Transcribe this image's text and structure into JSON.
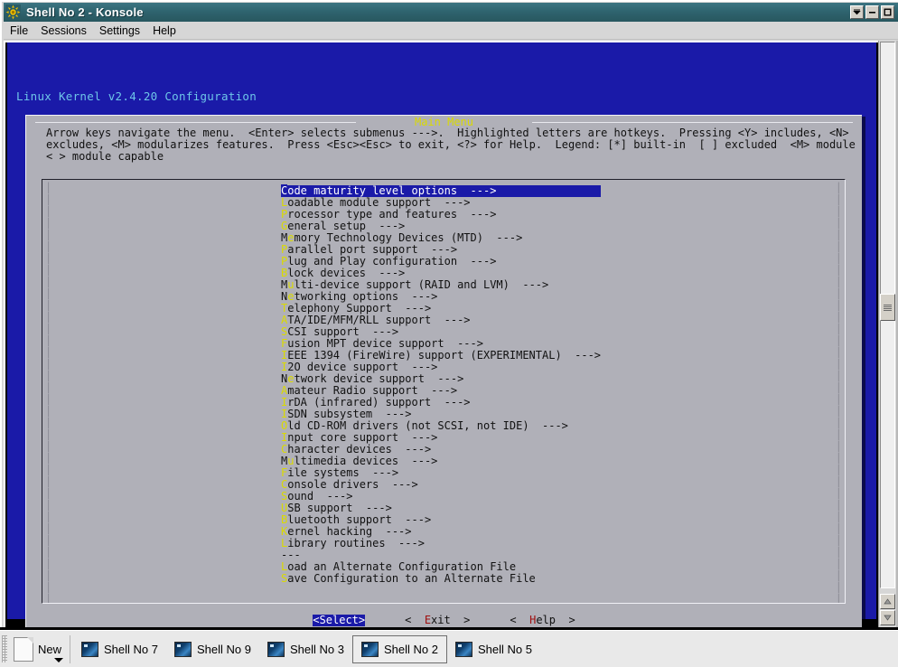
{
  "window": {
    "title": "Shell No 2 - Konsole",
    "icon": "konsole-sun-icon",
    "buttons": [
      {
        "name": "shade-button",
        "glyph": "shade"
      },
      {
        "name": "minimize-button",
        "glyph": "minimize"
      },
      {
        "name": "maximize-button",
        "glyph": "maximize"
      }
    ]
  },
  "menubar": {
    "items": [
      {
        "label": "File"
      },
      {
        "label": "Sessions"
      },
      {
        "label": "Settings"
      },
      {
        "label": "Help"
      }
    ]
  },
  "terminal": {
    "kernel_title": "Linux Kernel v2.4.20 Configuration",
    "dialog_title": "Main Menu",
    "help_lines": [
      "Arrow keys navigate the menu.  <Enter> selects submenus --->.  Highlighted letters are hotkeys.  Pressing <Y> includes, <N>",
      "excludes, <M> modularizes features.  Press <Esc><Esc> to exit, <?> for Help.  Legend: [*] built-in  [ ] excluded  <M> module",
      "< > module capable"
    ],
    "menu_items": [
      {
        "hotkey": "C",
        "rest": "ode maturity level options",
        "arrow": "  --->",
        "selected": true
      },
      {
        "hotkey": "L",
        "rest": "oadable module support",
        "arrow": "  --->",
        "selected": false
      },
      {
        "hotkey": "P",
        "rest": "rocessor type and features",
        "arrow": "  --->",
        "selected": false
      },
      {
        "hotkey": "G",
        "rest": "eneral setup",
        "arrow": "  --->",
        "selected": false
      },
      {
        "hotkey": "e",
        "rest": "",
        "prefix": "M",
        "suffix": "mory Technology Devices (MTD)",
        "arrow": "  --->",
        "selected": false
      },
      {
        "hotkey": "P",
        "rest": "arallel port support",
        "arrow": "  --->",
        "selected": false
      },
      {
        "hotkey": "P",
        "rest": "lug and Play configuration",
        "arrow": "  --->",
        "selected": false
      },
      {
        "hotkey": "B",
        "rest": "lock devices",
        "arrow": "  --->",
        "selected": false
      },
      {
        "hotkey": "u",
        "prefix": "M",
        "suffix": "lti-device support (RAID and LVM)",
        "rest": "",
        "arrow": "  --->",
        "selected": false
      },
      {
        "hotkey": "e",
        "prefix": "N",
        "suffix": "tworking options",
        "rest": "",
        "arrow": "  --->",
        "selected": false
      },
      {
        "hotkey": "T",
        "rest": "elephony Support",
        "arrow": "  --->",
        "selected": false
      },
      {
        "hotkey": "A",
        "rest": "TA/IDE/MFM/RLL support",
        "arrow": "  --->",
        "selected": false
      },
      {
        "hotkey": "S",
        "rest": "CSI support",
        "arrow": "  --->",
        "selected": false
      },
      {
        "hotkey": "F",
        "rest": "usion MPT device support",
        "arrow": "  --->",
        "selected": false
      },
      {
        "hotkey": "I",
        "rest": "EEE 1394 (FireWire) support (EXPERIMENTAL)",
        "arrow": "  --->",
        "selected": false
      },
      {
        "hotkey": "I",
        "rest": "2O device support",
        "arrow": "  --->",
        "selected": false
      },
      {
        "hotkey": "e",
        "prefix": "N",
        "suffix": "twork device support",
        "rest": "",
        "arrow": "  --->",
        "selected": false
      },
      {
        "hotkey": "A",
        "rest": "mateur Radio support",
        "arrow": "  --->",
        "selected": false
      },
      {
        "hotkey": "I",
        "rest": "rDA (infrared) support",
        "arrow": "  --->",
        "selected": false
      },
      {
        "hotkey": "I",
        "rest": "SDN subsystem",
        "arrow": "  --->",
        "selected": false
      },
      {
        "hotkey": "O",
        "rest": "ld CD-ROM drivers (not SCSI, not IDE)",
        "arrow": "  --->",
        "selected": false
      },
      {
        "hotkey": "I",
        "rest": "nput core support",
        "arrow": "  --->",
        "selected": false
      },
      {
        "hotkey": "C",
        "rest": "haracter devices",
        "arrow": "  --->",
        "selected": false
      },
      {
        "hotkey": "u",
        "prefix": "M",
        "suffix": "ltimedia devices",
        "rest": "",
        "arrow": "  --->",
        "selected": false
      },
      {
        "hotkey": "F",
        "rest": "ile systems",
        "arrow": "  --->",
        "selected": false
      },
      {
        "hotkey": "C",
        "rest": "onsole drivers",
        "arrow": "  --->",
        "selected": false
      },
      {
        "hotkey": "S",
        "rest": "ound",
        "arrow": "  --->",
        "selected": false
      },
      {
        "hotkey": "U",
        "rest": "SB support",
        "arrow": "  --->",
        "selected": false
      },
      {
        "hotkey": "B",
        "rest": "luetooth support",
        "arrow": "  --->",
        "selected": false
      },
      {
        "hotkey": "K",
        "rest": "ernel hacking",
        "arrow": "  --->",
        "selected": false
      },
      {
        "hotkey": "L",
        "rest": "ibrary routines",
        "arrow": "  --->",
        "selected": false
      },
      {
        "hotkey": "",
        "rest": "---",
        "arrow": "",
        "selected": false
      },
      {
        "hotkey": "L",
        "rest": "oad an Alternate Configuration File",
        "arrow": "",
        "selected": false
      },
      {
        "hotkey": "S",
        "rest": "ave Configuration to an Alternate File",
        "arrow": "",
        "selected": false
      }
    ],
    "buttons": [
      {
        "name": "select-button",
        "pre": "<",
        "hotkey": "S",
        "post": "elect>",
        "selected": true
      },
      {
        "name": "exit-button",
        "pre": "<  ",
        "hotkey": "E",
        "post": "xit  >",
        "selected": false
      },
      {
        "name": "help-button",
        "pre": "<  ",
        "hotkey": "H",
        "post": "elp  >",
        "selected": false
      }
    ]
  },
  "scrollbar": {
    "up_arrow": "▲",
    "down_arrow": "▼"
  },
  "taskbar": {
    "new_label": "New",
    "tasks": [
      {
        "label": "Shell No 7",
        "active": false
      },
      {
        "label": "Shell No 9",
        "active": false
      },
      {
        "label": "Shell No 3",
        "active": false
      },
      {
        "label": "Shell No 2",
        "active": true
      },
      {
        "label": "Shell No 5",
        "active": false
      }
    ]
  },
  "colors": {
    "titlebar": "#2f646f",
    "app_blue": "#1a1aa8",
    "dialog_gray": "#b0b0b8",
    "hotkey_yellow": "#dada00",
    "kernel_cyan": "#6ec6e8",
    "button_hotkey_red": "#a01010"
  }
}
